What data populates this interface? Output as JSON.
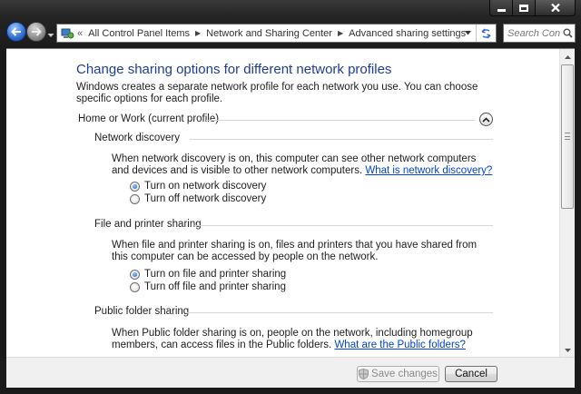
{
  "window": {
    "minimize_icon": "minimize-icon",
    "maximize_icon": "maximize-icon",
    "close_icon": "close-icon"
  },
  "nav": {
    "address_icon": "control-panel-icon",
    "overflow": "«",
    "breadcrumbs": [
      "All Control Panel Items",
      "Network and Sharing Center",
      "Advanced sharing settings"
    ],
    "search_placeholder": "Search Con..."
  },
  "page": {
    "title": "Change sharing options for different network profiles",
    "intro": "Windows creates a separate network profile for each network you use. You can choose specific options for each profile.",
    "profile_heading": "Home or Work (current profile)",
    "sections": [
      {
        "heading": "Network discovery",
        "description": "When network discovery is on, this computer can see other network computers and devices and is visible to other network computers.",
        "link": "What is network discovery?",
        "options": [
          {
            "label": "Turn on network discovery",
            "selected": true
          },
          {
            "label": "Turn off network discovery",
            "selected": false
          }
        ]
      },
      {
        "heading": "File and printer sharing",
        "description": "When file and printer sharing is on, files and printers that you have shared from this computer can be accessed by people on the network.",
        "options": [
          {
            "label": "Turn on file and printer sharing",
            "selected": true
          },
          {
            "label": "Turn off file and printer sharing",
            "selected": false
          }
        ]
      },
      {
        "heading": "Public folder sharing",
        "description": "When Public folder sharing is on, people on the network, including homegroup members, can access files in the Public folders.",
        "link": "What are the Public folders?"
      }
    ]
  },
  "footer": {
    "save_label": "Save changes",
    "cancel_label": "Cancel"
  },
  "colors": {
    "title": "#1e3d96",
    "link": "#0044cc",
    "frame": "#1b1b1b"
  }
}
